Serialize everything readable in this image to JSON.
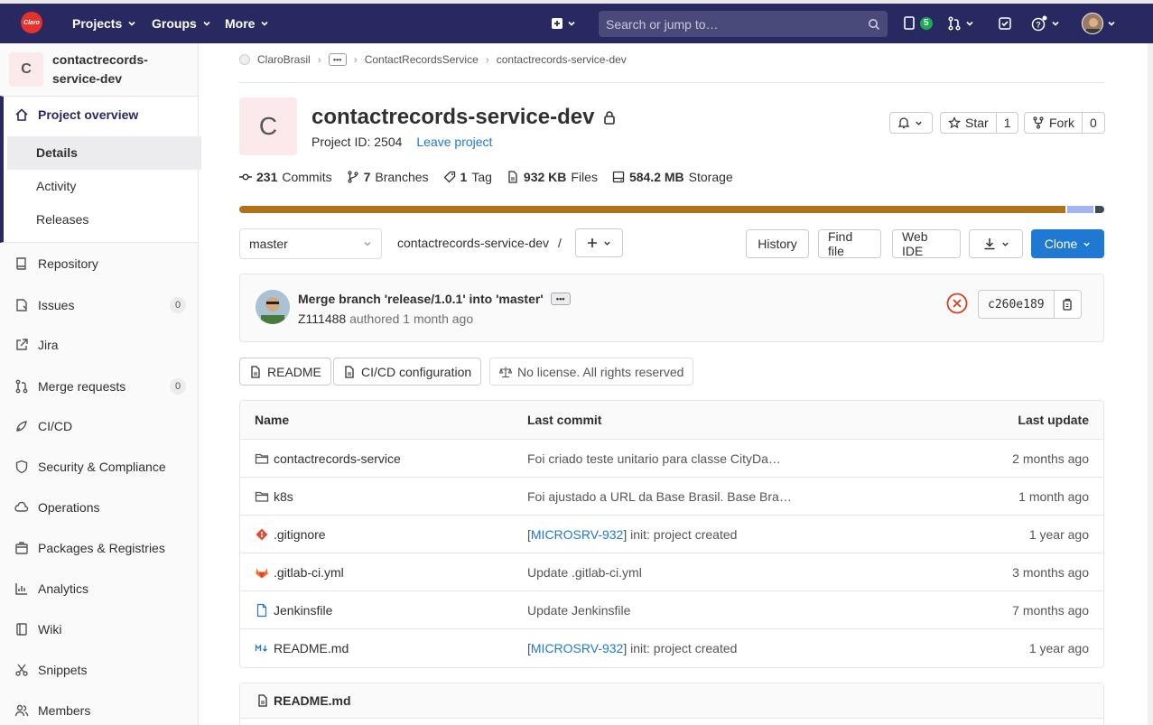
{
  "topbar": {
    "logo_text": "Claro",
    "projects": "Projects",
    "groups": "Groups",
    "more": "More",
    "search_placeholder": "Search or jump to…",
    "issues_count": "5"
  },
  "sidebar": {
    "project_initial": "C",
    "project_name": "contactrecords-service-dev",
    "overview": "Project overview",
    "sub_items": [
      "Details",
      "Activity",
      "Releases"
    ],
    "items": [
      {
        "label": "Repository"
      },
      {
        "label": "Issues",
        "count": "0"
      },
      {
        "label": "Jira"
      },
      {
        "label": "Merge requests",
        "count": "0"
      },
      {
        "label": "CI/CD"
      },
      {
        "label": "Security & Compliance"
      },
      {
        "label": "Operations"
      },
      {
        "label": "Packages & Registries"
      },
      {
        "label": "Analytics"
      },
      {
        "label": "Wiki"
      },
      {
        "label": "Snippets"
      },
      {
        "label": "Members"
      }
    ]
  },
  "breadcrumb": {
    "group": "ClaroBrasil",
    "ellipsis": "•••",
    "subgroup": "ContactRecordsService",
    "project": "contactrecords-service-dev"
  },
  "project": {
    "initial": "C",
    "title": "contactrecords-service-dev",
    "id_text": "Project ID: 2504",
    "leave": "Leave project",
    "star_label": "Star",
    "star_count": "1",
    "fork_label": "Fork",
    "fork_count": "0"
  },
  "stats": {
    "commits_num": "231",
    "commits_label": "Commits",
    "branches_num": "7",
    "branches_label": "Branches",
    "tags_num": "1",
    "tags_label": "Tag",
    "files_num": "932 KB",
    "files_label": "Files",
    "storage_num": "584.2 MB",
    "storage_label": "Storage"
  },
  "languages": [
    {
      "color": "#b07219",
      "share": 0.955
    },
    {
      "color": "#a3b3f0",
      "share": 0.033
    },
    {
      "color": "#384d54",
      "share": 0.012
    }
  ],
  "toolbar": {
    "branch": "master",
    "path": "contactrecords-service-dev",
    "path_sep": "/",
    "plus": "+",
    "history": "History",
    "find_file": "Find file",
    "web_ide": "Web IDE",
    "clone": "Clone"
  },
  "commit": {
    "message": "Merge branch 'release/1.0.1' into 'master'",
    "ellipsis": "•••",
    "author": "Z111488",
    "authored": "authored",
    "time": "1 month ago",
    "sha": "c260e189"
  },
  "pills": {
    "readme": "README",
    "cicd": "CI/CD configuration",
    "license": "No license. All rights reserved"
  },
  "files": {
    "headers": {
      "name": "Name",
      "commit": "Last commit",
      "update": "Last update"
    },
    "rows": [
      {
        "icon": "folder-icon",
        "name": "contactrecords-service",
        "commit_prefix": "",
        "commit_link": "",
        "commit": "Foi criado teste unitario para classe CityDa…",
        "date": "2 months ago"
      },
      {
        "icon": "folder-icon",
        "name": "k8s",
        "commit_prefix": "",
        "commit_link": "",
        "commit": "Foi ajustado a URL da Base Brasil. Base Bra…",
        "date": "1 month ago"
      },
      {
        "icon": "git-icon",
        "name": ".gitignore",
        "commit_prefix": "[",
        "commit_link": "MICROSRV-932",
        "commit": "] init: project created",
        "date": "1 year ago"
      },
      {
        "icon": "gitlab-icon",
        "name": ".gitlab-ci.yml",
        "commit_prefix": "",
        "commit_link": "",
        "commit": "Update .gitlab-ci.yml",
        "date": "3 months ago"
      },
      {
        "icon": "file-icon",
        "name": "Jenkinsfile",
        "commit_prefix": "",
        "commit_link": "",
        "commit": "Update Jenkinsfile",
        "date": "7 months ago"
      },
      {
        "icon": "markdown-icon",
        "name": "README.md",
        "commit_prefix": "[",
        "commit_link": "MICROSRV-932",
        "commit": "] init: project created",
        "date": "1 year ago"
      }
    ]
  },
  "readme_panel": {
    "title": "README.md"
  }
}
